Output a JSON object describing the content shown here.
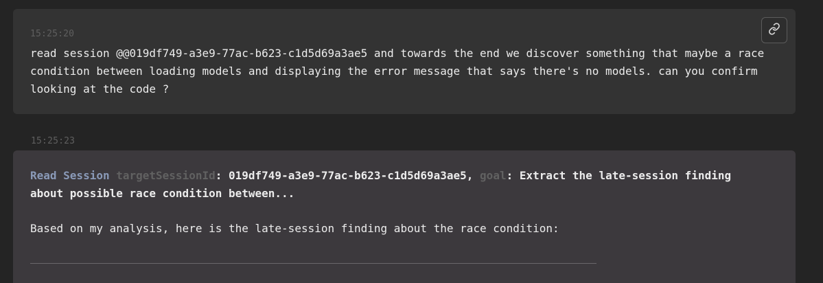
{
  "messages": {
    "user": {
      "timestamp": "15:25:20",
      "text": "read session @@019df749-a3e9-77ac-b623-c1d5d69a3ae5 and towards the end we discover something that maybe a race condition between loading models and displaying the error message that says there's no models. can you confirm looking at the code ?",
      "link_icon": "link-icon"
    },
    "assistant": {
      "timestamp": "15:25:23",
      "tool_call": {
        "name": "Read Session",
        "param1_key": "targetSessionId",
        "param1_sep": ": ",
        "param1_value": "019df749-a3e9-77ac-b623-c1d5d69a3ae5",
        "comma": ", ",
        "param2_key": "goal",
        "param2_sep": ": ",
        "param2_value": "Extract the late-session finding about possible race condition between..."
      },
      "reply": "Based on my analysis, here is the late-session finding about the race condition:"
    }
  },
  "colors": {
    "background": "#242424",
    "user_card": "#333333",
    "assistant_card": "#3c393d",
    "tool_name": "#8a9ab8",
    "param_key": "#616161",
    "text": "#ececec"
  }
}
